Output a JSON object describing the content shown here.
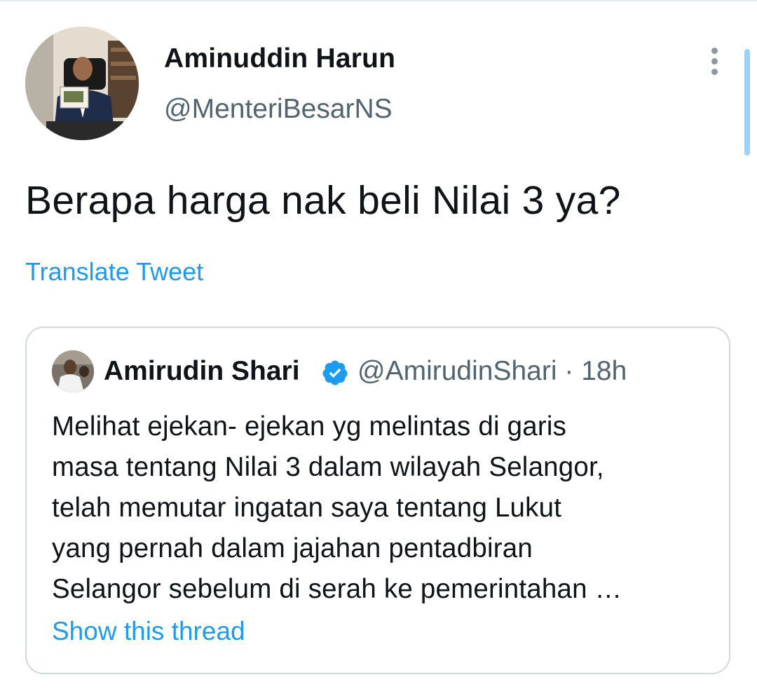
{
  "tweet": {
    "author": {
      "name": "Aminuddin Harun",
      "handle": "@MenteriBesarNS",
      "avatar_icon": "profile-photo-icon"
    },
    "text": "Berapa harga nak beli Nilai 3 ya?",
    "translate_label": "Translate Tweet",
    "more_icon": "more-vertical-icon"
  },
  "quoted_tweet": {
    "author": {
      "name": "Amirudin Shari",
      "handle": "@AmirudinShari",
      "verified": true,
      "avatar_icon": "profile-photo-icon"
    },
    "separator": "·",
    "time": "18h",
    "text_lines": [
      "Melihat ejekan- ejekan yg melintas di garis",
      "masa tentang Nilai 3 dalam wilayah Selangor,",
      "telah memutar ingatan saya tentang Lukut",
      "yang pernah dalam jajahan pentadbiran",
      "Selangor sebelum di serah ke pemerintahan …"
    ],
    "show_thread_label": "Show this thread"
  },
  "colors": {
    "link": "#1d9bf0",
    "secondary_text": "#536471",
    "primary_text": "#0f1419",
    "border": "#cfd9de",
    "verified": "#1d9bf0"
  }
}
